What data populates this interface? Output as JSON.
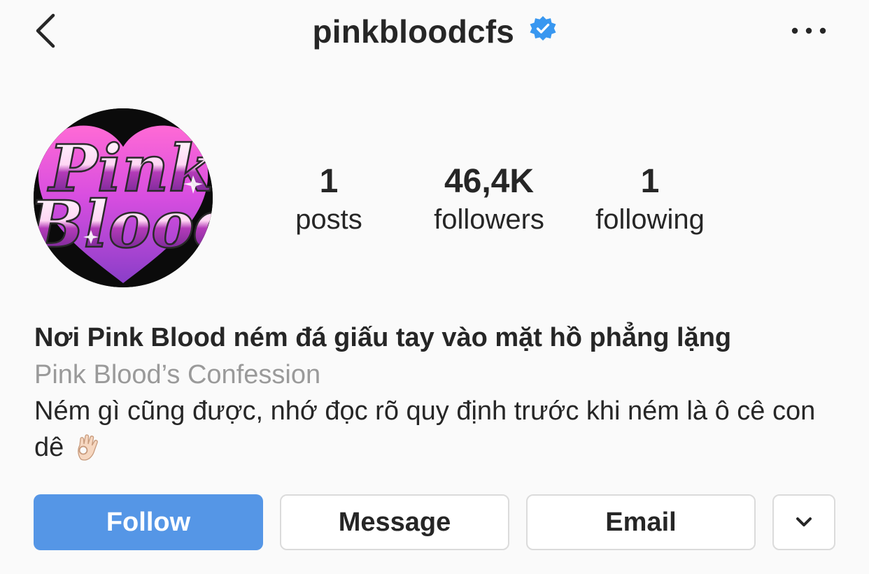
{
  "header": {
    "username": "pinkbloodcfs",
    "verified_color": "#3897f0"
  },
  "avatar": {
    "line1": "Pink",
    "line2": "Blood"
  },
  "stats": [
    {
      "value": "1",
      "label": "posts"
    },
    {
      "value": "46,4K",
      "label": "followers"
    },
    {
      "value": "1",
      "label": "following"
    }
  ],
  "bio": {
    "name": "Nơi Pink Blood ném đá giấu tay vào mặt hồ phẳng lặng",
    "category": "Pink Blood’s Confession",
    "text": "Ném gì cũng được, nhớ đọc rõ quy định trước khi ném là ô cê con dê"
  },
  "actions": {
    "follow": "Follow",
    "message": "Message",
    "email": "Email"
  },
  "colors": {
    "accent": "#5596e6",
    "text": "#262626",
    "secondary": "#9a9a9a",
    "border": "#dbdbdb",
    "background": "#fafafa"
  },
  "icons": [
    "chevron-left-icon",
    "verified-badge-icon",
    "more-horizontal-icon",
    "ok-hand-emoji-icon",
    "chevron-down-icon"
  ]
}
